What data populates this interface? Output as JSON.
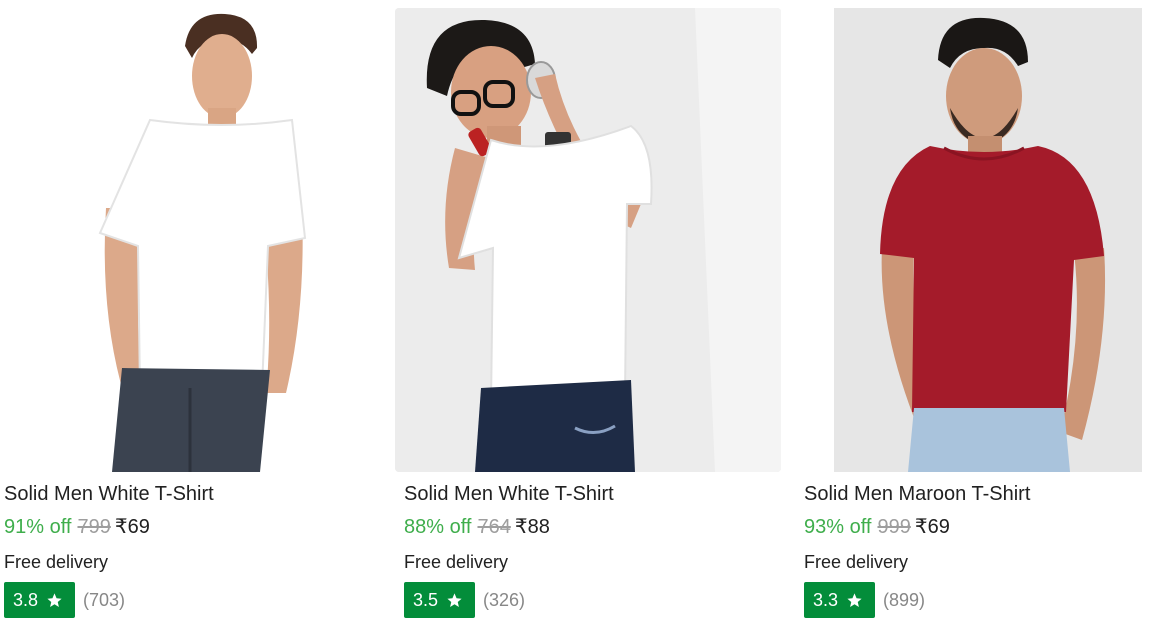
{
  "products": [
    {
      "title": "Solid Men White T-Shirt",
      "discount": "91% off",
      "mrp": "799",
      "price": "₹69",
      "delivery": "Free delivery",
      "rating": "3.8",
      "rating_count": "(703)",
      "shirt_color": "#ffffff",
      "jeans_color": "#3b4350"
    },
    {
      "title": "Solid Men White T-Shirt",
      "discount": "88% off",
      "mrp": "764",
      "price": "₹88",
      "delivery": "Free delivery",
      "rating": "3.5",
      "rating_count": "(326)",
      "shirt_color": "#ffffff",
      "jeans_color": "#1e2b45"
    },
    {
      "title": "Solid Men Maroon T-Shirt",
      "discount": "93% off",
      "mrp": "999",
      "price": "₹69",
      "delivery": "Free delivery",
      "rating": "3.3",
      "rating_count": "(899)",
      "shirt_color": "#a41b2a",
      "jeans_color": "#a9c3dc"
    }
  ],
  "colors": {
    "discount_green": "#3fae4c",
    "rating_green": "#038d3a",
    "muted_gray": "#9e9e9e"
  },
  "icons": {
    "rating": "star-icon"
  }
}
